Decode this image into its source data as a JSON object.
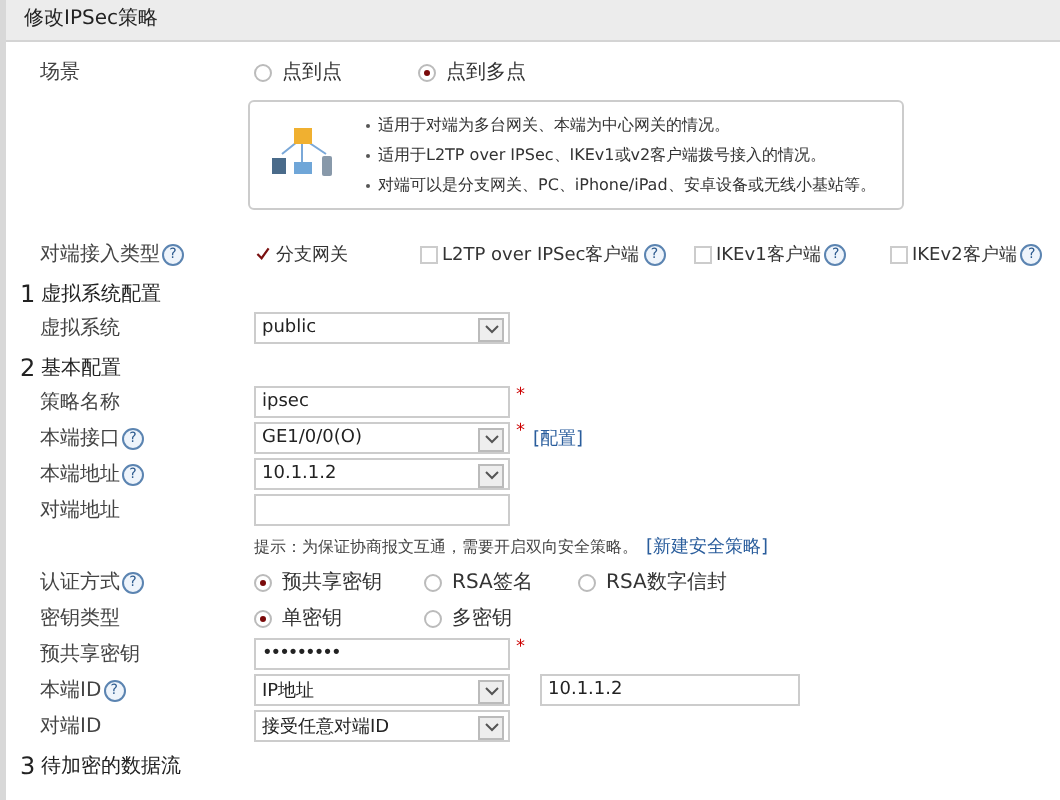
{
  "title": "修改IPSec策略",
  "scenario": {
    "label": "场景",
    "options": [
      {
        "label": "点到点",
        "selected": false
      },
      {
        "label": "点到多点",
        "selected": true
      }
    ]
  },
  "tip": {
    "bullets": [
      "适用于对端为多台网关、本端为中心网关的情况。",
      "适用于L2TP over IPSec、IKEv1或v2客户端拨号接入的情况。",
      "对端可以是分支网关、PC、iPhone/iPad、安卓设备或无线小基站等。"
    ]
  },
  "peer_access": {
    "label": "对端接入类型",
    "help": "?",
    "options": [
      {
        "label": "分支网关",
        "checked": true
      },
      {
        "label": "L2TP over IPSec客户端",
        "checked": false,
        "help": "?"
      },
      {
        "label": "IKEv1客户端",
        "checked": false,
        "help": "?"
      },
      {
        "label": "IKEv2客户端",
        "checked": false,
        "help": "?"
      }
    ]
  },
  "sections": [
    {
      "number": "1",
      "title": "虚拟系统配置",
      "fields": [
        {
          "kind": "select",
          "label": "虚拟系统",
          "value": "public"
        }
      ]
    },
    {
      "number": "2",
      "title": "基本配置",
      "fields": [
        {
          "kind": "input",
          "label": "策略名称",
          "value": "ipsec",
          "required_mark": "*"
        },
        {
          "kind": "select",
          "label": "本端接口",
          "help": "?",
          "value": "GE1/0/0(O)",
          "required_mark": "*",
          "link": "[配置]"
        },
        {
          "kind": "select",
          "label": "本端地址",
          "help": "?",
          "value": "10.1.1.2"
        },
        {
          "kind": "input",
          "label": "对端地址"
        },
        {
          "kind": "hint",
          "text": "提示：为保证协商报文互通，需要开启双向安全策略。",
          "link": "[新建安全策略]"
        },
        {
          "kind": "radio",
          "label": "认证方式",
          "help": "?",
          "options": [
            {
              "label": "预共享密钥",
              "selected": true
            },
            {
              "label": "RSA签名",
              "selected": false
            },
            {
              "label": "RSA数字信封",
              "selected": false
            }
          ]
        },
        {
          "kind": "radio",
          "label": "密钥类型",
          "options": [
            {
              "label": "单密钥",
              "selected": true
            },
            {
              "label": "多密钥",
              "selected": false
            }
          ]
        },
        {
          "kind": "password",
          "label": "预共享密钥",
          "value": "•••••••••",
          "required_mark": "*"
        },
        {
          "kind": "select",
          "label": "本端ID",
          "help": "?",
          "value": "IP地址",
          "extra_value": "10.1.1.2"
        },
        {
          "kind": "select",
          "label": "对端ID",
          "value": "接受任意对端ID"
        }
      ]
    },
    {
      "number": "3",
      "title": "待加密的数据流"
    }
  ]
}
